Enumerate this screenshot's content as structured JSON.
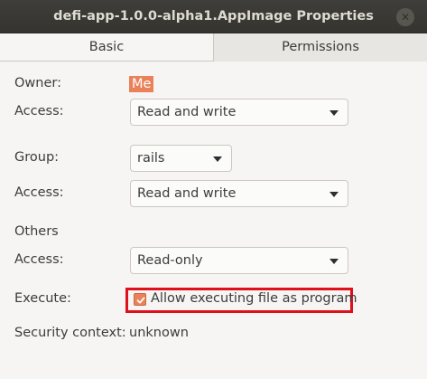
{
  "window": {
    "title": "defi-app-1.0.0-alpha1.AppImage Properties"
  },
  "tabs": [
    {
      "label": "Basic",
      "active": false
    },
    {
      "label": "Permissions",
      "active": true
    }
  ],
  "owner": {
    "label": "Owner:",
    "value": "Me",
    "access_label": "Access:",
    "access_value": "Read and write"
  },
  "group": {
    "label": "Group:",
    "value": "rails",
    "access_label": "Access:",
    "access_value": "Read and write"
  },
  "others": {
    "label": "Others",
    "access_label": "Access:",
    "access_value": "Read-only"
  },
  "execute": {
    "label": "Execute:",
    "checkbox_label": "Allow executing file as program",
    "checked": true
  },
  "security": {
    "label": "Security context:",
    "value": "unknown"
  },
  "colors": {
    "accent": "#e9825a",
    "highlight_border": "#e0101a",
    "titlebar": "#3c3b37"
  }
}
